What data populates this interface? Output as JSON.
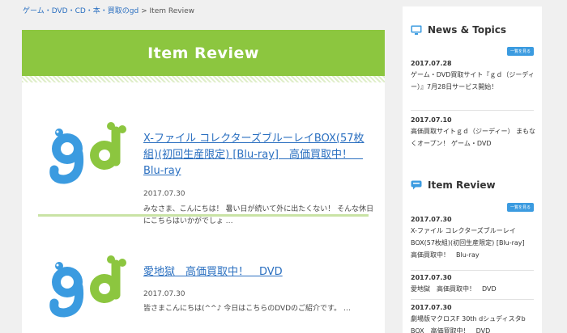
{
  "breadcrumb": {
    "home": "ゲーム・DVD・CD・本・買取のgd",
    "sep": ">",
    "current": "Item Review"
  },
  "main": {
    "header": "Item Review",
    "items": [
      {
        "title": "X-ファイル コレクターズブルーレイBOX(57枚組)(初回生産限定) [Blu-ray]　高価買取中！　Blu-ray",
        "date": "2017.07.30",
        "excerpt": "みなさま、こんにちは！ 暑い日が続いて外に出たくない！ そんな休日にこちらはいかがでしょ …"
      },
      {
        "title": "愛地獄　高価買取中！　DVD",
        "date": "2017.07.30",
        "excerpt": "皆さまこんにちは(^^♪ 今日はこちらのDVDのご紹介です。 …"
      }
    ]
  },
  "sidebar": {
    "news": {
      "heading": "News & Topics",
      "see_all": "一覧を見る",
      "entries": [
        {
          "date": "2017.07.28",
          "text": "ゲーム・DVD買取サイト『ｇｄ（ジーディー）』7月28日サービス開始！"
        },
        {
          "date": "2017.07.10",
          "text": "高価買取サイトｇｄ（ジーディー） まもなくオープン！ ゲーム・DVD"
        }
      ]
    },
    "review": {
      "heading": "Item Review",
      "see_all": "一覧を見る",
      "entries": [
        {
          "date": "2017.07.30",
          "text": "X-ファイル コレクターズブルーレイBOX(57枚組)(初回生産限定) [Blu-ray]　高価買取中！　Blu-ray"
        },
        {
          "date": "2017.07.30",
          "text": "愛地獄　高価買取中！　DVD"
        },
        {
          "date": "2017.07.30",
          "text": "劇場版マクロスF 30th dシュディスタb BOX　高価買取中！　DVD"
        }
      ]
    }
  },
  "colors": {
    "green": "#8cc63f",
    "blue": "#3b9be0",
    "link": "#2a6fc0"
  },
  "icons": {
    "logo": "gd-logo",
    "news": "monitor-icon",
    "review": "chat-bubble-icon"
  }
}
